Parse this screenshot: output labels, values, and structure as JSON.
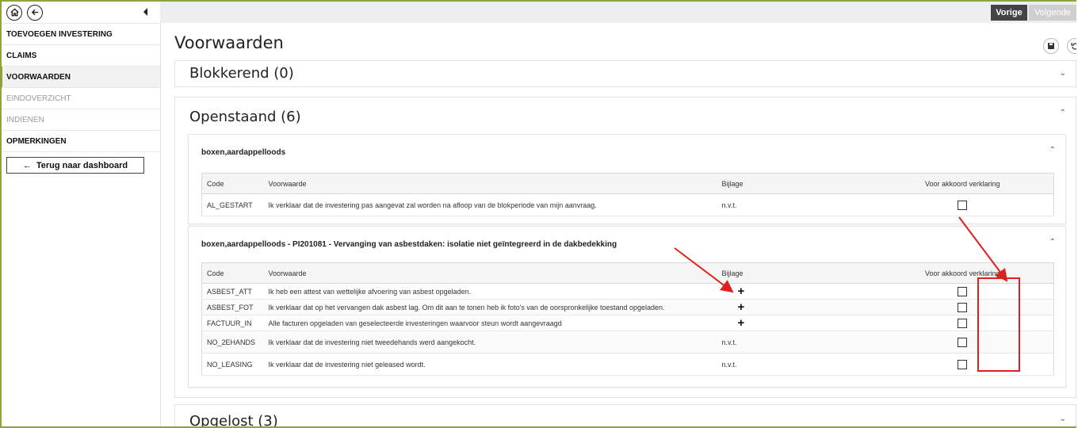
{
  "sidebar": {
    "home_icon": "home-icon",
    "back_icon": "arrow-left-icon",
    "items": [
      {
        "label": "TOEVOEGEN INVESTERING"
      },
      {
        "label": "CLAIMS"
      },
      {
        "label": "VOORWAARDEN"
      },
      {
        "label": "EINDOVERZICHT"
      },
      {
        "label": "INDIENEN"
      },
      {
        "label": "OPMERKINGEN"
      }
    ],
    "back_button": "Terug naar dashboard"
  },
  "topbar": {
    "prev": "Vorige",
    "next": "Volgende"
  },
  "page_title": "Voorwaarden",
  "sections": {
    "blokkerend": "Blokkerend (0)",
    "openstaand": "Openstaand (6)",
    "opgelost": "Opgelost (3)"
  },
  "table_headers": {
    "code": "Code",
    "voorwaarde": "Voorwaarde",
    "bijlage": "Bijlage",
    "akkoord": "Voor akkoord verklaring"
  },
  "group1": {
    "title": "boxen,aardappelloods",
    "rows": [
      {
        "code": "AL_GESTART",
        "text": "Ik verklaar dat de investering pas aangevat zal worden na afloop van de blokperiode van mijn aanvraag.",
        "bijlage": "n.v.t."
      }
    ]
  },
  "group2": {
    "title": "boxen,aardappelloods - PI201081 - Vervanging van asbestdaken: isolatie niet geïntegreerd in de dakbedekking",
    "rows": [
      {
        "code": "ASBEST_ATT",
        "text": "Ik heb een attest van wettelijke afvoering van asbest opgeladen.",
        "bijlage": "+"
      },
      {
        "code": "ASBEST_FOT",
        "text": "Ik verklaar dat op het vervangen dak asbest lag. Om dit aan te tonen heb ik foto's van de oorspronkelijke toestand opgeladen.",
        "bijlage": "+"
      },
      {
        "code": "FACTUUR_IN",
        "text": "Alle facturen opgeladen van geselecteerde investeringen waarvoor steun wordt aangevraagd",
        "bijlage": "+"
      },
      {
        "code": "NO_2EHANDS",
        "text": "Ik verklaar dat de investering niet tweedehands werd aangekocht.",
        "bijlage": "n.v.t."
      },
      {
        "code": "NO_LEASING",
        "text": "Ik verklaar dat de investering niet geleased wordt.",
        "bijlage": "n.v.t."
      }
    ]
  },
  "colors": {
    "accent": "#8da33f",
    "annotation": "#e02020",
    "dark_button": "#444444"
  }
}
